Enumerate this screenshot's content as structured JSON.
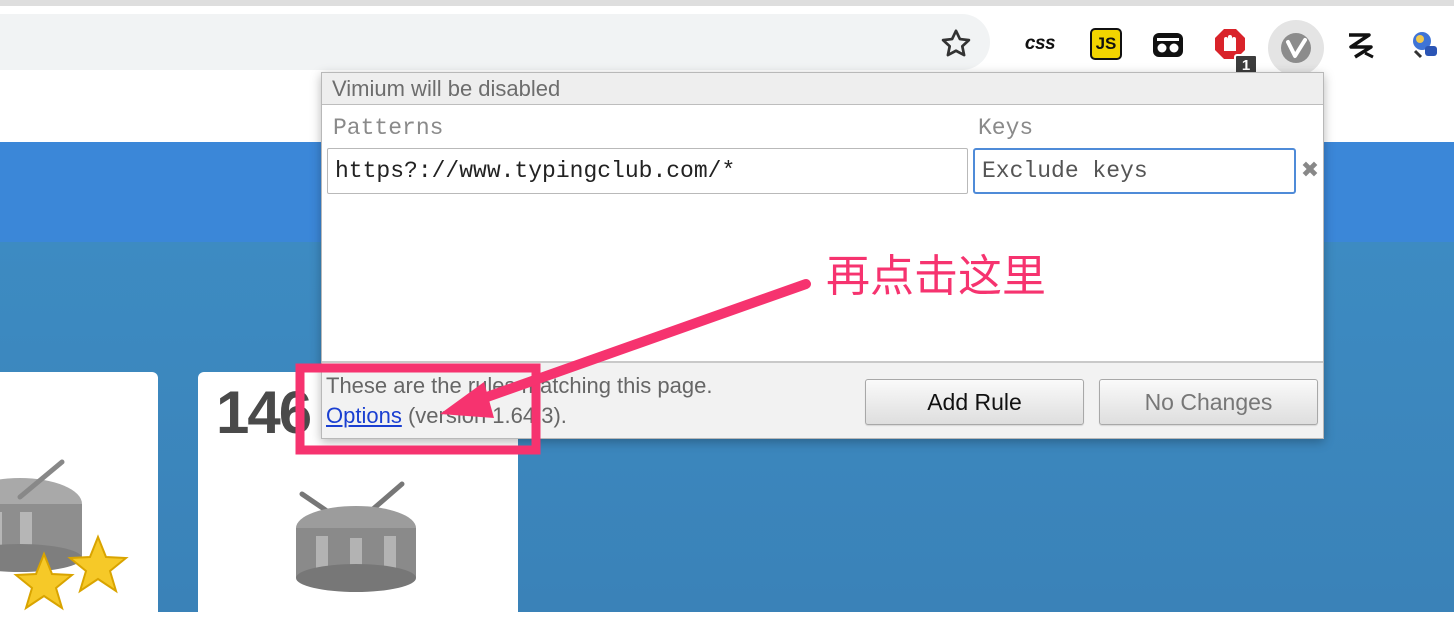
{
  "toolbar": {
    "bookmark_icon": "star-icon",
    "extensions": [
      {
        "name": "css-icon",
        "label": "css"
      },
      {
        "name": "js-icon",
        "label": "JS"
      },
      {
        "name": "glasses-icon",
        "label": ""
      },
      {
        "name": "adblock-icon",
        "badge": "1"
      },
      {
        "name": "vimium-icon",
        "label": ""
      },
      {
        "name": "zigzag-icon",
        "label": ""
      },
      {
        "name": "extension-icon",
        "label": ""
      }
    ]
  },
  "page": {
    "card_number": "146"
  },
  "popup": {
    "title": "Vimium will be disabled",
    "patterns_header": "Patterns",
    "keys_header": "Keys",
    "pattern_value": "https?://www.typingclub.com/*",
    "keys_placeholder": "Exclude keys",
    "remove_glyph": "✖",
    "footer_text": "These are the rules matching this page.",
    "options_link": "Options",
    "version_text": "(version 1.64.3).",
    "add_rule_label": "Add Rule",
    "no_changes_label": "No Changes"
  },
  "annotation": {
    "text": "再点击这里",
    "color": "#f6336f"
  },
  "colors": {
    "header_blue": "#3b87d8",
    "body_blue": "#3d8bc2",
    "link_blue": "#1a3fd1",
    "focus_blue": "#4f8bd8"
  }
}
